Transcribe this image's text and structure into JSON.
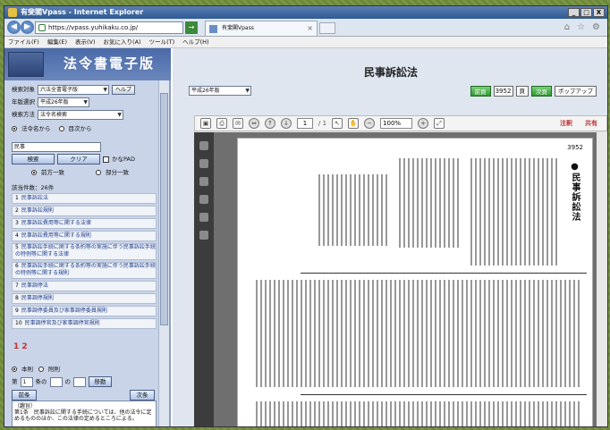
{
  "window": {
    "title": "有斐閣Vpass - Internet Explorer",
    "controls": [
      "_",
      "□",
      "X"
    ]
  },
  "browser": {
    "url": "https://vpass.yuhikaku.co.jp/",
    "tab_label": "有斐閣Vpass",
    "tab_close": "×",
    "menu": [
      "ファイル(F)",
      "編集(E)",
      "表示(V)",
      "お気に入り(A)",
      "ツール(T)",
      "ヘルプ(H)"
    ]
  },
  "sidebar": {
    "logo_text": "法令書電子版",
    "book_label": "検索対象",
    "book_value": "六法全書電子版",
    "help_button": "ヘルプ",
    "year_label": "年版選択",
    "year_value": "平成26年版",
    "method_label": "検索方法",
    "method_value": "法令名検索",
    "mode_options": [
      "法令名から",
      "目次から"
    ],
    "query": "民事",
    "search_button": "検索",
    "clear_button": "クリア",
    "kana_label": "かなPAD",
    "match_options": [
      "前方一致",
      "部分一致"
    ],
    "result_count": "該当件数：26件",
    "results": [
      {
        "n": "1",
        "t": "民事訴訟法"
      },
      {
        "n": "2",
        "t": "民事訴訟規則"
      },
      {
        "n": "3",
        "t": "民事訴訟費用等に関する法律"
      },
      {
        "n": "4",
        "t": "民事訴訟費用等に関する規則"
      },
      {
        "n": "5",
        "t": "民事訴訟手続に関する条約等の実施に伴う民事訴訟手続の特例等に関する法律"
      },
      {
        "n": "6",
        "t": "民事訴訟手続に関する条約等の実施に伴う民事訴訟手続の特例等に関する規則"
      },
      {
        "n": "7",
        "t": "民事調停法"
      },
      {
        "n": "8",
        "t": "民事調停規則"
      },
      {
        "n": "9",
        "t": "民事調停委員及び家事調停委員規則"
      },
      {
        "n": "10",
        "t": "民事調停官及び家事調停官規則"
      }
    ],
    "pages": "1 2",
    "scope_options": [
      "本則",
      "附則"
    ],
    "article": {
      "prefix": "第",
      "value": "1",
      "jo": "条の",
      "no": "の",
      "move": "移動"
    },
    "first_button": "前条",
    "next_button": "次条",
    "note_title": "（趣旨）",
    "note_text": "第1条　民事訴訟に関する手続については、他の法令に定めるもののほか、この法律の定めるところによる。"
  },
  "main": {
    "title": "民事訴訟法",
    "era": "平成26年版",
    "prev_button": "前頁",
    "page": "3952",
    "page_suffix": "頁",
    "next_button": "次頁",
    "popup_button": "ポップアップ",
    "pdf": {
      "page_current": "1",
      "page_total": "/ 1",
      "zoom": "100%",
      "annotate": "注釈",
      "share": "共有",
      "page_number": "3952",
      "page_title": "●民事訴訟法"
    }
  }
}
